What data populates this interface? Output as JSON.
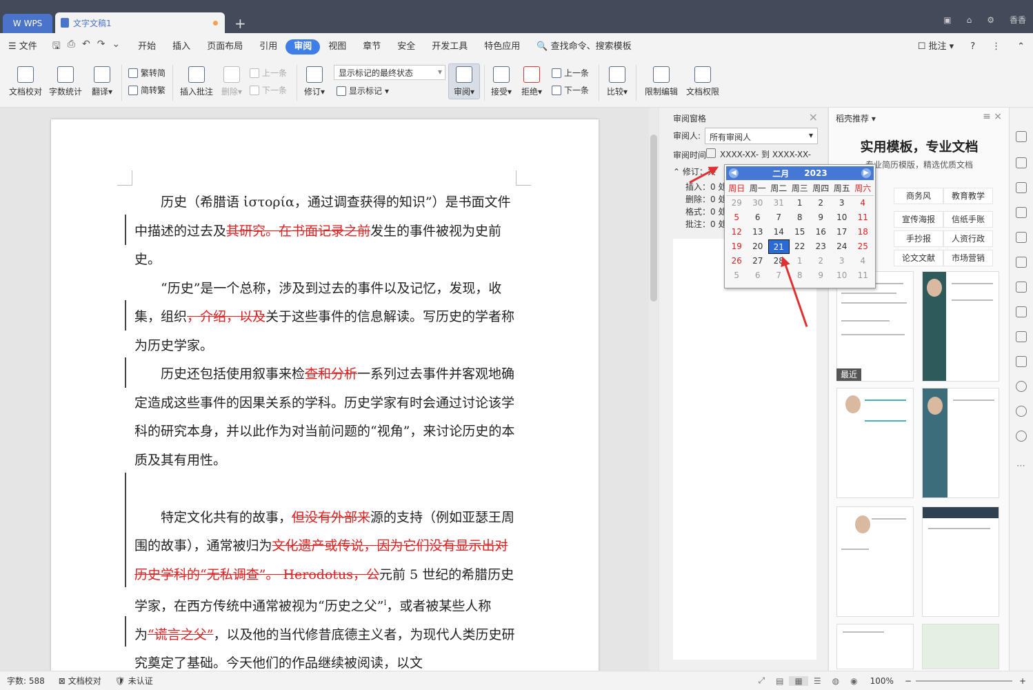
{
  "titlebar": {
    "app_tab": "WPS",
    "doc_tab": "文字文稿1",
    "user": "香香"
  },
  "menu": {
    "file": "文件",
    "items": [
      "开始",
      "插入",
      "页面布局",
      "引用",
      "审阅",
      "视图",
      "章节",
      "安全",
      "开发工具",
      "特色应用"
    ],
    "search": "查找命令、搜索模板",
    "comment": "批注"
  },
  "ribbon": {
    "doc_check": "文档校对",
    "word_count": "字数统计",
    "translate": "翻译",
    "trad": "繁转简",
    "simp": "简转繁",
    "insert_comment": "插入批注",
    "delete": "删除",
    "prev_c": "上一条",
    "next_c": "下一条",
    "revise": "修订",
    "display_select": "显示标记的最终状态",
    "show_markup": "显示标记",
    "review": "审阅",
    "accept": "接受",
    "reject": "拒绝",
    "prev": "上一条",
    "next": "下一条",
    "compare": "比较",
    "restrict": "限制编辑",
    "perm": "文档权限"
  },
  "document": {
    "p1a": "历史（希腊语 ἱστορία，通过调查获得的知识”）是书面文件中描述的过去及",
    "p1del": "其研究。在书面记录之前",
    "p1b": "发生的事件被视为史前史。",
    "p2a": "“历史”是一个总称，涉及到过去的事件以及记忆，发现，收集，组织",
    "p2del": "，介绍，以及",
    "p2b": "关于这些事件的信息解读。写历史的学者称为历史学家。",
    "p3a": "历史还包括使用叙事来检",
    "p3del": "查和分析",
    "p3b": "一系列过去事件并客观地确定造成这些事件的因果关系的学科。历史学家有时会通过讨论该学科的研究本身，并以此作为对当前问题的“视角”，来讨论历史的本质及其有用性。",
    "p4a": "特定文化共有的故事，",
    "p4del1": "但没有外部来",
    "p4b": "源的支持（例如亚瑟王周围的故事），通常被归为",
    "p4del2": "文化遗产或传说，因为它们没有显示出对历史学科的“无私调查”。 Herodotus，公",
    "p4c": "元前 5 世纪的希腊历史学家，在西方传统中通常被视为“历史之父”",
    "p4d": "，或者被某些人称为",
    "p4del3": "“谎言之父”",
    "p4e": "，以及他的当代修昔底德主义者，为现代人类历史研究奠定了基础。今天他们的作品继续被阅读，以文"
  },
  "review_pane": {
    "title": "审阅窗格",
    "reviewer_label": "审阅人:",
    "reviewer": "所有审阅人",
    "time_label": "审阅时间",
    "time_value": "XXXX-XX- 到 XXXX-XX-",
    "revisions": "修订：共",
    "insert": "插入：0 处",
    "delete": "删除：0 处",
    "format": "格式：0 处",
    "comment": "批注：0 处"
  },
  "calendar": {
    "month": "二月",
    "year": "2023",
    "weekdays": [
      "周日",
      "周一",
      "周二",
      "周三",
      "周四",
      "周五",
      "周六"
    ],
    "weeks": [
      [
        "29",
        "30",
        "31",
        "1",
        "2",
        "3",
        "4"
      ],
      [
        "5",
        "6",
        "7",
        "8",
        "9",
        "10",
        "11"
      ],
      [
        "12",
        "13",
        "14",
        "15",
        "16",
        "17",
        "18"
      ],
      [
        "19",
        "20",
        "21",
        "22",
        "23",
        "24",
        "25"
      ],
      [
        "26",
        "27",
        "28",
        "1",
        "2",
        "3",
        "4"
      ],
      [
        "5",
        "6",
        "7",
        "8",
        "9",
        "10",
        "11"
      ]
    ],
    "selected": "21"
  },
  "templates": {
    "header": "稻壳推荐",
    "title": "实用模板，专业文档",
    "subtitle": "专业简历模版，精选优质文档",
    "cats": [
      "商务风",
      "教育教学",
      "宣传海报",
      "信纸手账",
      "手抄报",
      "人资行政",
      "论文文献",
      "市场营销"
    ],
    "recent": "最近"
  },
  "status": {
    "words": "字数: 588",
    "check": "文档校对",
    "cert": "未认证",
    "zoom": "100%"
  },
  "colors": {
    "accent": "#3f7ee8",
    "deletion": "#e02020",
    "titlebar": "#434a5a",
    "arrow": "#e03030"
  }
}
